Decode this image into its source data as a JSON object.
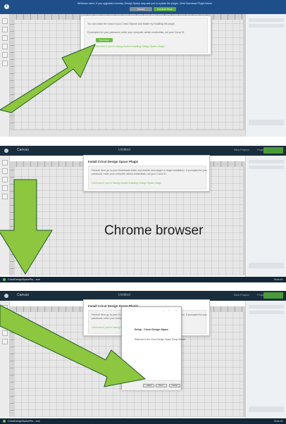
{
  "panel1": {
    "notice": {
      "message": "Windows users: If you upgraded recently, Design Space may ask you to update the plugin. Click Download Plugin below.",
      "button_dismiss": "Dismiss",
      "button_download": "Download Plugin"
    },
    "modal": {
      "line1": "You can make the most of your Cricut Explore and Maker by installing the plugin.",
      "line2": "If prompted for your password, enter your computer admin credentials, not your Cricut ID.",
      "download_button": "Download",
      "link": "Click here if you're having trouble installing Design Space plugin"
    }
  },
  "panel2": {
    "topbar": {
      "title": "Canvas",
      "project": "Untitled",
      "right_link": "New Project",
      "user": "Projects"
    },
    "modal": {
      "title": "Install Cricut Design Space Plugin",
      "line1": "Perfect! Now go to your Downloads folder and double click plugin to begin installation. If prompted for your",
      "line2": "password, enter your computer admin credentials, not your Cricut ID.",
      "link": "Click here if you're having trouble installing Design Space plugin"
    },
    "caption": "Chrome browser",
    "download": {
      "filename": "CricutDesignSpacePlu....exe",
      "show_all": "Show all"
    }
  },
  "panel3": {
    "topbar": {
      "title": "Canvas",
      "project": "Untitled",
      "right_link": "New Project",
      "user": "Projects"
    },
    "modal": {
      "title": "Install Cricut Design Space Plugin",
      "line1": "Perfect! Now go to your Downloads folder and double click plugin to begin installation. If prompted for your",
      "line2": "password, enter your computer admin credentials, not your Cricut ID.",
      "link": "Click here if you're having trouble installing Design Space plugin"
    },
    "dialog": {
      "heading": "Setup - Cricut Design Space",
      "text": "Welcome to the Cricut Design Space Setup Wizard",
      "back": "< Back",
      "next": "Next >",
      "cancel": "Cancel"
    },
    "download": {
      "filename": "CricutDesignSpacePlu....exe",
      "show_all": "Show all"
    }
  },
  "colors": {
    "arrow_green": "#8dc63f",
    "arrow_outline": "#1e5a28",
    "topbar_navy": "#1a2d3d",
    "notice_blue": "#1e4f8a",
    "accent_green": "#6cbd45"
  },
  "icons": [
    "info-icon",
    "cricut-logo-icon",
    "download-status-icon"
  ]
}
